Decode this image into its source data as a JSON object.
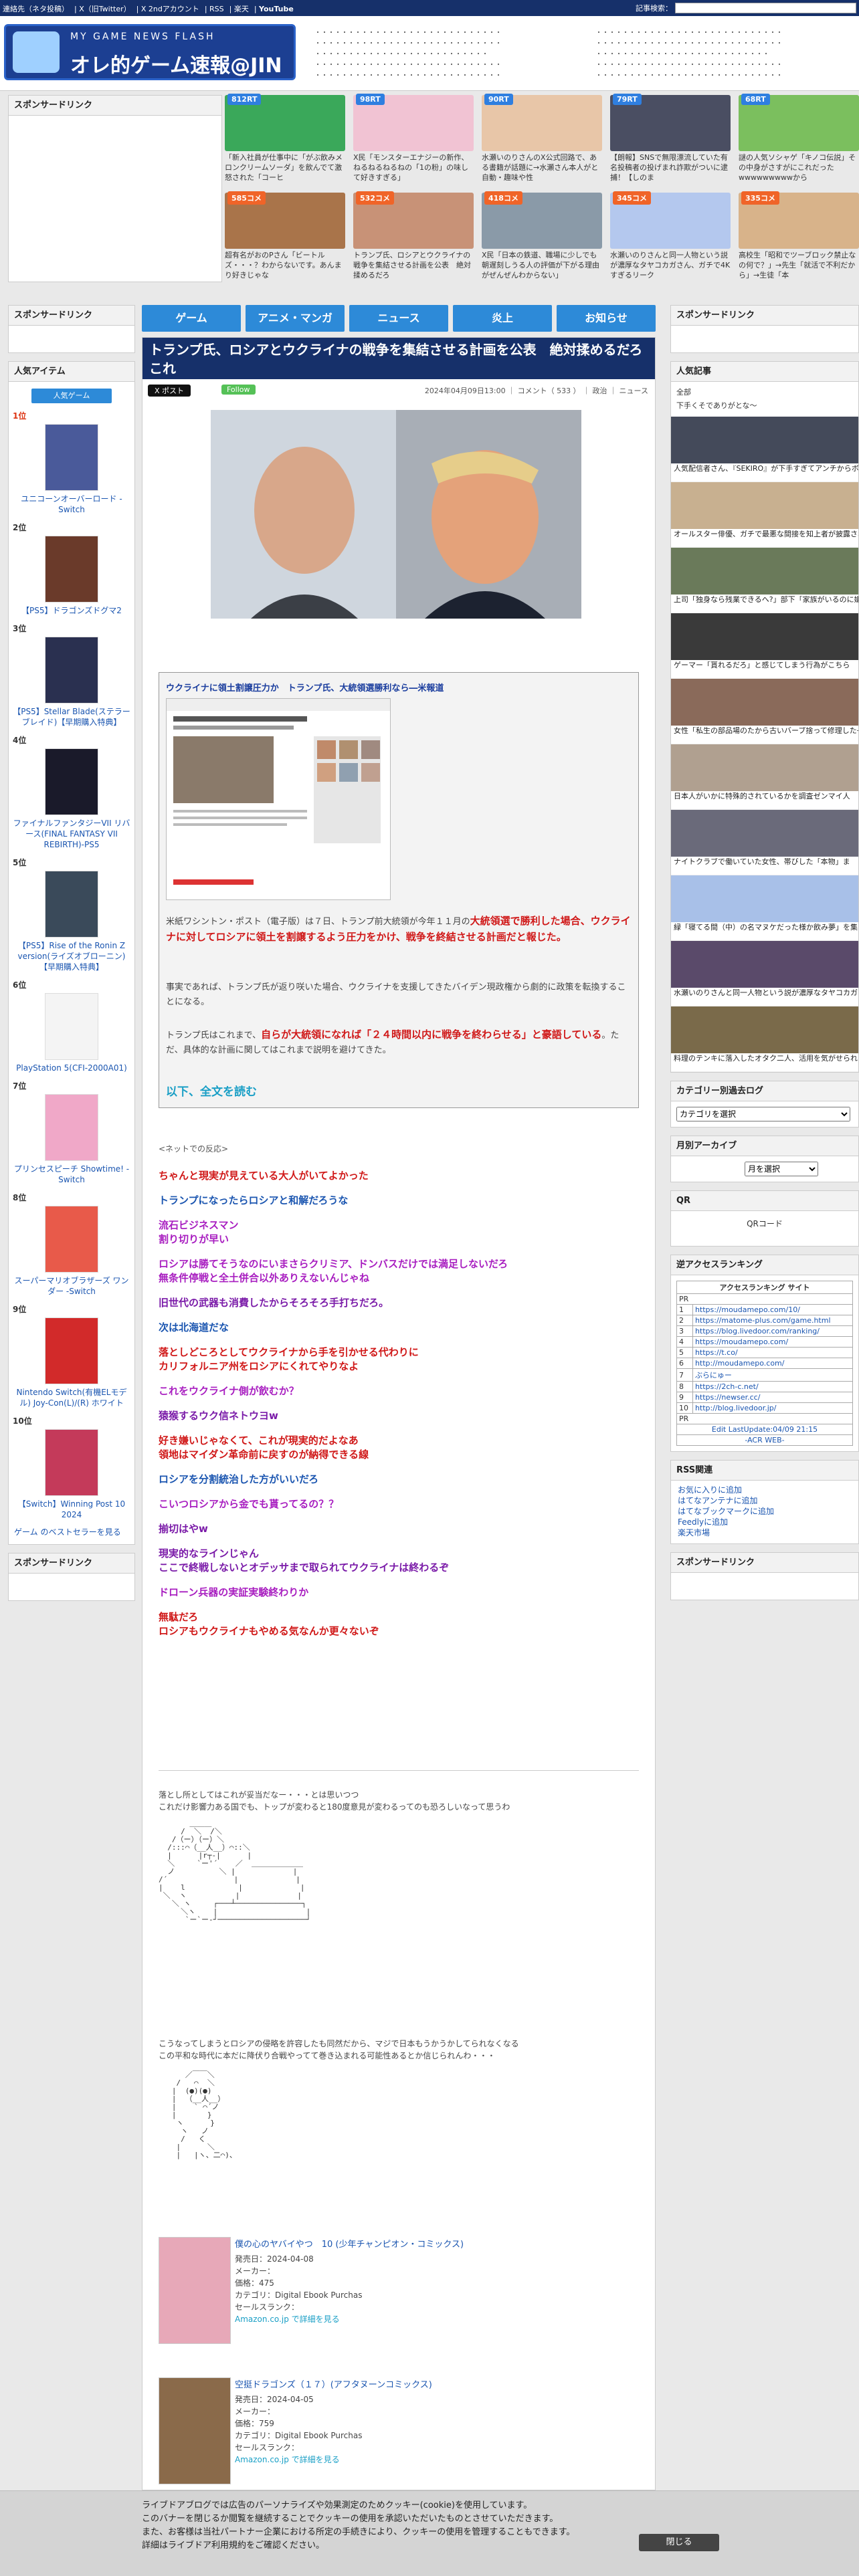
{
  "topbar": {
    "links": [
      "連絡先（ネタ投稿）",
      "X（旧Twitter）",
      "X 2ndアカウント",
      "RSS",
      "楽天",
      "YouTube"
    ],
    "search_label": "記事検索："
  },
  "logo": {
    "line1": "MY GAME NEWS FLASH",
    "line2": "オレ的ゲーム速報@JIN"
  },
  "sponsor_label": "スポンサードリンク",
  "thumbs": [
    {
      "badge": "812RT",
      "caption": "「新入社員が仕事中に「がぶ飲みメロンクリームソーダ」を飲んでて激怒された「コーヒ"
    },
    {
      "badge": "98RT",
      "caption": "X民「モンスターエナジーの新作、ねるねるねるねの「1の粉」の味して好きすぎる」"
    },
    {
      "badge": "90RT",
      "caption": "水瀬いのりさんのX公式回路で、ある書籍が話題に→水瀬さん本人がと自動・趣味や性"
    },
    {
      "badge": "79RT",
      "caption": "【朗報】SNSで無限漂流していた有名投稿者の投げまれ詐欺がついに逮捕！【しのま"
    },
    {
      "badge": "68RT",
      "caption": "謎の人気ソシャゲ「キノコ伝説」その中身がさすがにこれだったwwwwwwwwwから"
    },
    {
      "badge": "585コメ",
      "caption": "超有名がおのPさん「ビートルズ・・・？わからないです。あんまり好きじゃな"
    },
    {
      "badge": "532コメ",
      "caption": "トランプ氏、ロシアとウクライナの戦争を集結させる計画を公表　絶対揉めるだろ"
    },
    {
      "badge": "418コメ",
      "caption": "X民「日本の鉄道、職場に少しでも朝遅刻しうる人の評価が下がる理由がぜんぜんわからない」"
    },
    {
      "badge": "345コメ",
      "caption": "水瀬いのりさんと同一人物という説が濃厚なタヤコカガさん、ガチで4Kすぎるリーク"
    },
    {
      "badge": "335コメ",
      "caption": "高校生「昭和でツーブロック禁止なの何で？」→先生「就活で不利だから」→生徒「本"
    }
  ],
  "nav": [
    "ゲーム",
    "アニメ・マンガ",
    "ニュース",
    "炎上",
    "お知らせ"
  ],
  "left": {
    "sponsor": "スポンサードリンク",
    "popular_head": "人気アイテム",
    "popular_btn": "人気ゲーム",
    "ranks": [
      {
        "rank": "1位",
        "name": "ユニコーンオーバーロード -Switch"
      },
      {
        "rank": "2位",
        "name": "【PS5】ドラゴンズドグマ2"
      },
      {
        "rank": "3位",
        "name": "【PS5】Stellar Blade(ステラーブレイド)【早期購入特典】"
      },
      {
        "rank": "4位",
        "name": "ファイナルファンタジーVII リバース(FINAL FANTASY VII REBIRTH)-PS5"
      },
      {
        "rank": "5位",
        "name": "【PS5】Rise of the Ronin Z version(ライズオブローニン)【早期購入特典】"
      },
      {
        "rank": "6位",
        "name": "PlayStation 5(CFI-2000A01)"
      },
      {
        "rank": "7位",
        "name": "プリンセスピーチ Showtime! -Switch"
      },
      {
        "rank": "8位",
        "name": "スーパーマリオブラザーズ ワンダー -Switch"
      },
      {
        "rank": "9位",
        "name": "Nintendo Switch(有機ELモデル) Joy-Con(L)/(R) ホワイト"
      },
      {
        "rank": "10位",
        "name": "【Switch】Winning Post 10 2024"
      }
    ],
    "bestseller": "ゲーム のベストセラーを見る",
    "sponsor2": "スポンサードリンク"
  },
  "article": {
    "title": "トランプ氏、ロシアとウクライナの戦争を集結させる計画を公表　絶対揉めるだろこれ",
    "x_btn": "X ポスト",
    "follow_btn": "Follow",
    "meta": "2024年04月09日13:00 ｜ コメント（ 533 ） ｜ 政治 ｜ ニュース",
    "embed_title": "ウクライナに領土割譲圧力か　トランプ氏、大統領選勝利なら―米報道",
    "p1_a": "米紙ワシントン・ポスト（電子版）は７日、トランプ前大統領が今年１１月の",
    "p1_b": "大統領選で勝利した場合、ウクライナに対してロシアに領土を割譲するよう圧力をかけ、戦争を終結させる計画だと報じた。",
    "p2": "事実であれば、トランプ氏が返り咲いた場合、ウクライナを支援してきたバイデン現政権から劇的に政策を転換することになる。",
    "p3_a": "トランプ氏はこれまで、",
    "p3_b": "自らが大統領になれば「２４時間以内に戦争を終わらせる」と豪語している",
    "p3_c": "。ただ、具体的な計画に関してはこれまで説明を避けてきた。",
    "more": "以下、全文を読む",
    "reactions_lead": "<ネットでの反応>",
    "comments": [
      {
        "text": "ちゃんと現実が見えている大人がいてよかった",
        "c": "c-r"
      },
      {
        "text": "トランプになったらロシアと和解だろうな",
        "c": "c-b"
      },
      {
        "text": "流石ビジネスマン\n割り切りが早い",
        "c": "c-p"
      },
      {
        "text": "ロシアは勝てそうなのにいまさらクリミア、ドンバスだけでは満足しないだろ\n無条件停戦と全土併合以外ありえないんじゃね",
        "c": "c-p"
      },
      {
        "text": "旧世代の武器も消費したからそろそろ手打ちだろ。",
        "c": "c-v"
      },
      {
        "text": "次は北海道だな",
        "c": "c-b"
      },
      {
        "text": "落としどころとしてウクライナから手を引かせる代わりに\nカリフォルニア州をロシアにくれてやりなよ",
        "c": "c-r"
      },
      {
        "text": "これをウクライナ側が飲むか？",
        "c": "c-p"
      },
      {
        "text": "猿猴するウク信ネトウヨw",
        "c": "c-v"
      },
      {
        "text": "好き嫌いじゃなくて、これが現実的だよなあ\n領地はマイダン革命前に戻すのが納得できる線",
        "c": "c-r"
      },
      {
        "text": "ロシアを分割統治した方がいいだろ",
        "c": "c-b"
      },
      {
        "text": "こいつロシアから金でも貰ってるの？？",
        "c": "c-p"
      },
      {
        "text": "揃切はやw",
        "c": "c-v"
      },
      {
        "text": "現実的なラインじゃん\nここで終戦しないとオデッサまで取られてウクライナは終わるぞ",
        "c": "c-v"
      },
      {
        "text": "ドローン兵器の実証実験終わりか",
        "c": "c-p"
      },
      {
        "text": "無駄だろ\nロシアもウクライナもやめる気なんか更々ないぞ",
        "c": "c-r"
      }
    ],
    "aa1_text": "落とし所としてはこれが妥当だなー・・・とは思いつつ\nこれだけ影響力ある国でも、トップが変わると180度意見が変わるってのも恐ろしいなって思うわ",
    "aa2_text": "こうなってしまうとロシアの侵略を許容したも同然だから、マジで日本もうかうかしてられなくなる\nこの平和な時代に本だに降伏り合戦やってて巻き込まれる可能性あるとか信じられんわ・・・",
    "products": [
      {
        "title": "僕の心のヤバイやつ　10 (少年チャンピオン・コミックス)",
        "date": "発売日：2024-04-08",
        "maker": "メーカー：",
        "price": "価格：475",
        "cat": "カテゴリ：Digital Ebook Purchas",
        "rank": "セールスランク：",
        "link": "Amazon.co.jp で詳細を見る"
      },
      {
        "title": "空挺ドラゴンズ（１７）(アフタヌーンコミックス)",
        "date": "発売日：2024-04-05",
        "maker": "メーカー：",
        "price": "価格：759",
        "cat": "カテゴリ：Digital Ebook Purchas",
        "rank": "セールスランク：",
        "link": "Amazon.co.jp で詳細を見る"
      }
    ]
  },
  "right": {
    "sponsor": "スポンサードリンク",
    "popular_head": "人気記事",
    "popular_intro": [
      "全部",
      "下手くそでありがとな～"
    ],
    "items": [
      "人気配信者さん、『SEKIRO』が下手すぎてアンチからボロクソ叩かれる → 飲料前線、その",
      "オールスター俳優、ガチで最悪な間接を知上者が披露されてしまうwwwwwwwwww",
      "上司「独身なら残業できるへ?」部下「家族がいるのに嫌がらせ残業してくれてるみな",
      "ゲーマー「貰れるだろ」と感じてしまう行為がこちら",
      "女性「私生の部品場のたから古いバーブ捨って修理した→それは感じることがない",
      "日本人がいかに特殊的されているかを調査ゼンマイ人",
      "ナイトクラブで働いていた女性、帯びした「本物」ま",
      "緑「寝てる間（中）の名マヌケだった様か飲み夢」を集めたら→ヤバさとSNS投稿を見つけ",
      "水瀬いのりさんと同一人物という説が濃厚なタヤコカガさん、ガチで4Kすぎるリーク",
      "料理のテンキに落入したオタク二人、活用を気がせられる→ 全本「ネクメちゃで"
    ],
    "category_head": "カテゴリー別過去ログ",
    "category_select": "カテゴリを選択",
    "archive_head": "月別アーカイブ",
    "archive_select": "月を選択",
    "qr_head": "QR",
    "qr_alt": "QRコード",
    "access_head": "逆アクセスランキング",
    "access_title": "アクセスランキング サイト",
    "access_pr": "PR",
    "access": [
      "https://moudamepo.com/10/",
      "https://matome-plus.com/game.html",
      "https://blog.livedoor.com/ranking/",
      "https://moudamepo.com/",
      "https://t.co/",
      "http://moudamepo.com/",
      "ぶらにゅー",
      "https://2ch-c.net/",
      "https://newser.cc/",
      "http://blog.livedoor.jp/"
    ],
    "access_pr2": "PR",
    "access_footer": "Edit LastUpdate:04/09 21:15",
    "access_credit": "-ACR WEB-",
    "rss_head": "RSS関連",
    "rss": [
      "お気に入りに追加",
      "はてなアンテナに追加",
      "はてなブックマークに追加",
      "Feedlyに追加",
      "楽天市場"
    ],
    "sponsor2": "スポンサードリンク"
  },
  "cookie": {
    "text1": "ライブドアブログでは広告のパーソナライズや効果測定のためクッキー(cookie)を使用しています。",
    "text2": "このバナーを閉じるか閲覧を継続することでクッキーの使用を承認いただいたものとさせていただきます。",
    "text3": "また、お客様は当社パートナー企業における所定の手続きにより、クッキーの使用を管理することもできます。",
    "text4": "詳細はライブドア利用規約をご確認ください。",
    "close": "閉じる"
  }
}
